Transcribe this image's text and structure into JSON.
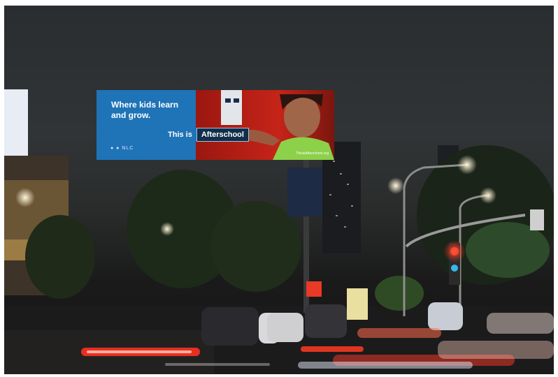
{
  "billboard": {
    "headline": "Where kids learn and grow.",
    "tag_prefix": "This is",
    "tag_word": "Afterschool",
    "sponsor_logos": "●  ●  NLC",
    "url": "ThisisAfterschool.org"
  },
  "colors": {
    "billboard_blue": "#1f73b7",
    "billboard_red": "#c62418",
    "night_sky": "#2c2f31",
    "traffic_red": "#ff3b2a",
    "street_light": "#fff3c8"
  }
}
